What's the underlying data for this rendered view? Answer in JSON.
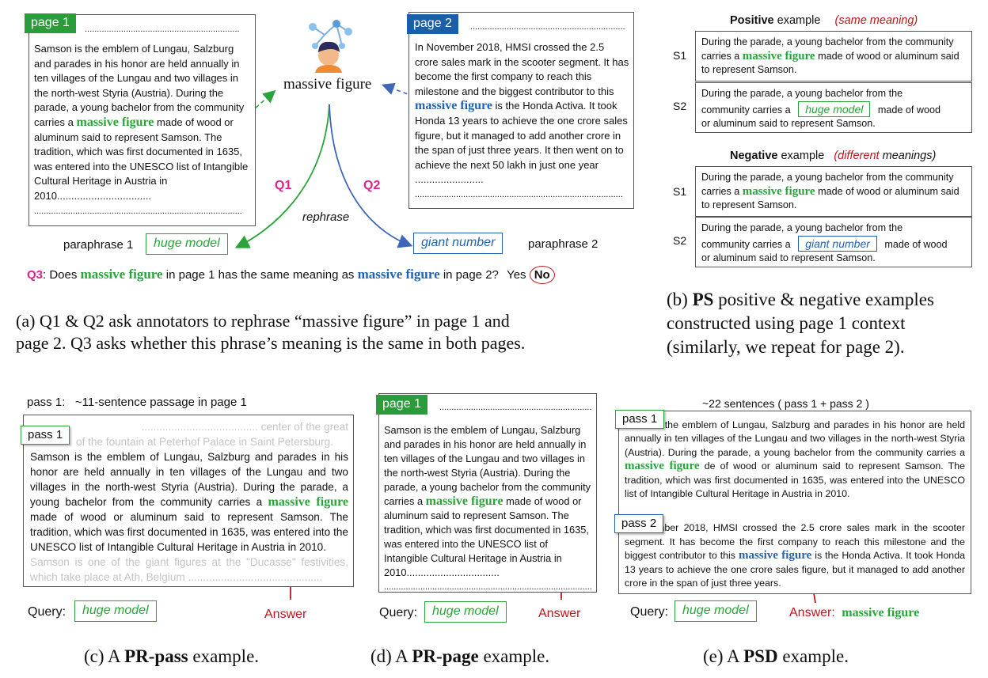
{
  "a": {
    "page1_tag": "page 1",
    "page1_dots": "................................................................",
    "page1_pre": "Samson is the emblem of Lungau, Salzburg and parades in his honor are held annually in ten villages of the Lungau and two villages in the north-west Styria (Austria). During the parade, a young bachelor from the community carries a",
    "page1_phrase": "massive figure",
    "page1_post": "made of wood or aluminum said to represent Samson. The tradition, which was first documented in 1635, was entered into the UNESCO list of Intangible Cultural Heritage in Austria in 2010.................................",
    "page1_tail": "......................................................................................",
    "page2_tag": "page 2",
    "page2_dots": "................................................................",
    "page2_pre": "In November 2018, HMSI crossed the 2.5 crore sales mark in the scooter segment. It has become the first company to reach this milestone and the biggest contributor to this",
    "page2_phrase": "massive figure",
    "page2_post": "is the Honda Activa.  It took Honda 13 years to achieve the one crore sales figure, but it managed to add another crore in the span of just three years. It then went on to achieve the next 50 lakh in just one year ........................",
    "page2_tail": "......................................................................................",
    "center_phrase": "massive figure",
    "q1": "Q1",
    "q2": "Q2",
    "rephrase": "rephrase",
    "paraphrase1_label": "paraphrase 1",
    "paraphrase1": "huge model",
    "paraphrase2_label": "paraphrase 2",
    "paraphrase2": "giant number",
    "q3_label": "Q3",
    "q3_a": ": Does",
    "q3_phrase1": "massive figure",
    "q3_b": "in page 1 has the same meaning as",
    "q3_phrase2": "massive figure",
    "q3_c": "in page 2?",
    "yes": "Yes",
    "no": "No",
    "caption_line1": "(a) Q1 & Q2 ask annotators to rephrase “massive figure” in page 1 and",
    "caption_line2": "page 2. Q3 asks whether this phrase’s meaning is the same in both pages."
  },
  "b": {
    "pos_bold": "Positive",
    "pos_rest": "example",
    "pos_paren": "(same meaning)",
    "neg_bold": "Negative",
    "neg_rest": "example",
    "neg_paren_open": "(",
    "neg_paren_word": "different",
    "neg_paren_close": "meanings)",
    "s1": "S1",
    "s2": "S2",
    "s_pre": "During the parade, a young bachelor from the community carries a",
    "s_phrase": "massive figure",
    "s_post": "made of wood or aluminum said to represent Samson.",
    "pos_s2_phrase": "huge model",
    "pos_s2_post1": "made of wood",
    "pos_s2_post2": "or aluminum said to represent Samson.",
    "neg_s2_phrase": "giant number",
    "neg_s2_post1": "made of wood",
    "neg_s2_post2": "or aluminum said to represent Samson.",
    "caption_pre": "(b)",
    "caption_bold": "PS",
    "caption_rest": "positive & negative examples",
    "caption_line2": "constructed using page 1 context",
    "caption_line3": "(similarly, we repeat for page 2)."
  },
  "c": {
    "heading": "pass 1:   ~11-sentence passage in page 1",
    "grey_top": "....................................... center of the great",
    "grey_top2": "of the fountain at Peterhof Palace in Saint Petersburg.",
    "pass_tag": "pass 1",
    "body_pre": "Samson is the emblem of Lungau, Salzburg and parades in his honor are held annually in ten villages of the Lungau and two villages in the north-west Styria (Austria). During the parade, a young bachelor from the community carries a",
    "body_phrase": "massive figure",
    "body_post": "made of wood or aluminum said to represent Samson. The tradition, which was first documented in 1635, was entered into the UNESCO list of Intangible Cultural Heritage in Austria in 2010.",
    "grey_bottom": "Samson is one of the giant figures at the \"Ducasse\" festivities, which take place at Ath, Belgium .............................................",
    "query_label": "Query:",
    "query": "huge model",
    "answer": "Answer",
    "caption_pre": "(c) A",
    "caption_bold": "PR-pass",
    "caption_rest": "example."
  },
  "d": {
    "tag": "page 1",
    "dots": "................................................................",
    "body_pre": "Samson is the emblem of Lungau, Salzburg and parades in his honor are held annually in ten villages of the Lungau and two villages in the north-west Styria (Austria). During the parade, a young bachelor from the community carries a",
    "body_phrase": "massive figure",
    "body_post": "made of wood or aluminum said to represent Samson. The tradition, which was first documented in 1635, was entered into the UNESCO list of Intangible Cultural Heritage in Austria in 2010.................................",
    "tail": "......................................................................................",
    "query_label": "Query:",
    "query": "huge model",
    "answer": "Answer",
    "caption_pre": "(d) A",
    "caption_bold": "PR-page",
    "caption_rest": "example."
  },
  "e": {
    "heading": "~22 sentences ( pass 1 + pass 2 )",
    "pass1_tag": "pass 1",
    "p1_pre": "s the emblem of Lungau, Salzburg and parades in his honor are held annually in ten villages of the Lungau and two villages in the north-west Styria (Austria). During the parade, a young bachelor from the community carries a",
    "p1_phrase": "massive figure",
    "p1_post": "de of wood or aluminum said to represent Samson. The tradition, which was first documented in 1635, was entered into the UNESCO list of Intangible Cultural Heritage in Austria in 2010.",
    "pass2_tag": "pass 2",
    "p2_pre": "mber 2018, HMSI crossed the 2.5 crore sales mark in the scooter segment. It has become the first company to reach this milestone and the biggest contributor to this",
    "p2_phrase": "massive figure",
    "p2_post": "is the Honda Activa. It took Honda 13 years to achieve the one crore sales figure, but it managed to add another crore in the span of just three years.",
    "query_label": "Query:",
    "query": "huge model",
    "answer_label": "Answer:",
    "answer": "massive figure",
    "caption_pre": "(e) A",
    "caption_bold": "PSD",
    "caption_rest": "example."
  },
  "colors": {
    "green": "#2aa43a",
    "blue": "#1f63b5",
    "magenta": "#e0208c",
    "red": "#c0141c"
  },
  "icons": [
    "user-network-icon"
  ]
}
